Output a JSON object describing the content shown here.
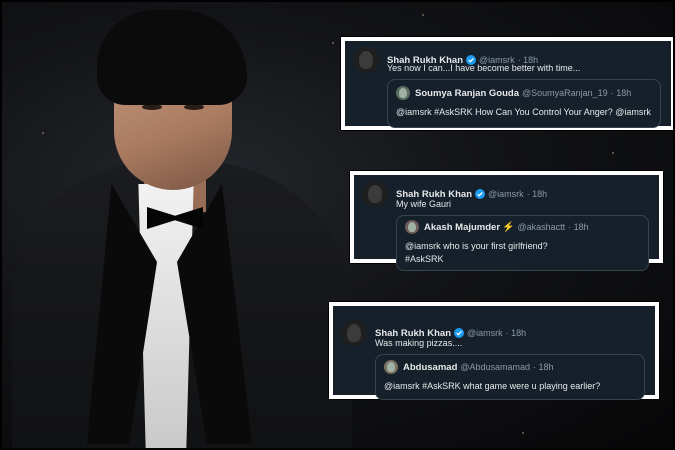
{
  "tweets": [
    {
      "author": {
        "name": "Shah Rukh Khan",
        "handle": "@iamsrk",
        "time": "· 18h",
        "verified": true
      },
      "text": "Yes now I can...I have become better with time...",
      "quoted": {
        "author": {
          "name": "Soumya Ranjan Gouda",
          "handle": "@SoumyaRanjan_19",
          "time": "· 18h"
        },
        "text": "@iamsrk #AskSRK How Can You Control Your Anger? @iamsrk"
      }
    },
    {
      "author": {
        "name": "Shah Rukh Khan",
        "handle": "@iamsrk",
        "time": "· 18h",
        "verified": true
      },
      "text": "My wife Gauri",
      "quoted": {
        "author": {
          "name": "Akash Majumder",
          "emoji": "⚡",
          "handle": "@akashactt",
          "time": "· 18h"
        },
        "text_lines": [
          "@iamsrk who is your first girlfriend?",
          "#AskSRK"
        ]
      }
    },
    {
      "author": {
        "name": "Shah Rukh Khan",
        "handle": "@iamsrk",
        "time": "· 18h",
        "verified": true
      },
      "text": "Was making pizzas....",
      "quoted": {
        "author": {
          "name": "Abdusamad",
          "handle": "@Abdusamamad",
          "time": "· 18h"
        },
        "text": "@iamsrk #AskSRK what game were u playing earlier?"
      }
    }
  ],
  "colors": {
    "card_bg": "#15202b",
    "verified": "#1d9bf0",
    "border": "#ffffff"
  },
  "icons": {
    "verified": "verified-badge-icon"
  }
}
